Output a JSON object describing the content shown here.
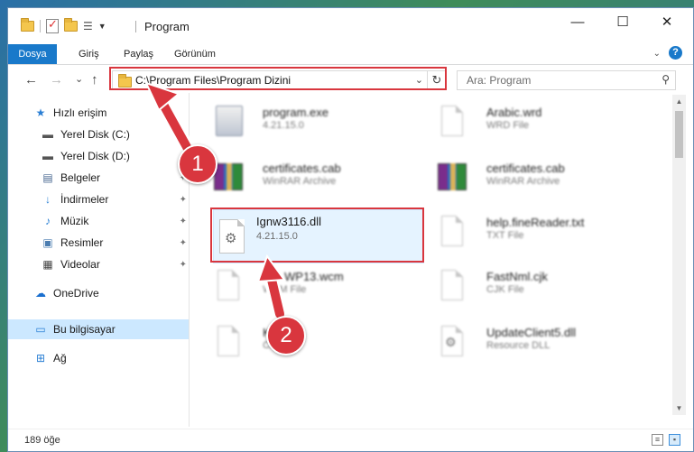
{
  "window": {
    "title": "Program",
    "controls": {
      "minimize": "—",
      "maximize": "☐",
      "close": "✕"
    }
  },
  "ribbon": {
    "tabs": [
      "Dosya",
      "Giriş",
      "Paylaş",
      "Görünüm"
    ],
    "active_tab": "Dosya",
    "help": "?"
  },
  "nav": {
    "back": "←",
    "forward": "→",
    "recent": "⌄",
    "up": "↑",
    "address": "C:\\Program Files\\Program Dizini",
    "refresh": "↻",
    "search_placeholder": "Ara: Program"
  },
  "sidebar": {
    "items": [
      {
        "label": "Hızlı erişim",
        "icon": "star-icon"
      },
      {
        "label": "Yerel Disk (C:)",
        "icon": "drive-icon",
        "pinned": true
      },
      {
        "label": "Yerel Disk (D:)",
        "icon": "drive-icon",
        "pinned": true
      },
      {
        "label": "Belgeler",
        "icon": "documents-icon",
        "pinned": true
      },
      {
        "label": "İndirmeler",
        "icon": "download-icon",
        "pinned": true
      },
      {
        "label": "Müzik",
        "icon": "music-icon",
        "pinned": true
      },
      {
        "label": "Resimler",
        "icon": "pictures-icon",
        "pinned": true
      },
      {
        "label": "Videolar",
        "icon": "videos-icon",
        "pinned": true
      },
      {
        "label": "OneDrive",
        "icon": "cloud-icon"
      },
      {
        "label": "Bu bilgisayar",
        "icon": "computer-icon",
        "selected": true
      },
      {
        "label": "Ağ",
        "icon": "network-icon"
      }
    ]
  },
  "files": [
    {
      "name": "program.exe",
      "meta": "4.21.15.0",
      "type": "exe"
    },
    {
      "name": "Arabic.wrd",
      "meta": "WRD File",
      "type": "doc"
    },
    {
      "name": "certificates.cab",
      "meta": "WinRAR Archive",
      "type": "rar"
    },
    {
      "name": "certificates.cab",
      "meta": "WinRAR Archive",
      "type": "rar"
    },
    {
      "name": "Ignw3116.dll",
      "meta": "4.21.15.0",
      "type": "dll",
      "highlighted": true
    },
    {
      "name": "help.fineReader.txt",
      "meta": "TXT File",
      "type": "doc"
    },
    {
      "name": "WP13.wcm",
      "meta": "WCM File",
      "type": "doc"
    },
    {
      "name": "FastNml.cjk",
      "meta": "CJK File",
      "type": "doc"
    },
    {
      "name": "Ko",
      "meta": "CK",
      "type": "doc"
    },
    {
      "name": "UpdateClient5.dll",
      "meta": "Resource DLL",
      "type": "dll"
    }
  ],
  "annotations": {
    "step1": "1",
    "step2": "2",
    "color": "#d9363e"
  },
  "status": {
    "count": "189 öğe"
  }
}
